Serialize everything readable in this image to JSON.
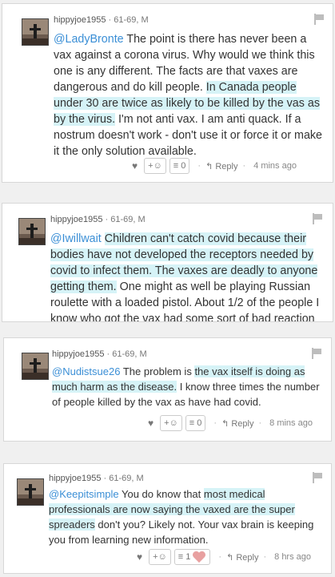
{
  "comments": [
    {
      "username": "hippyjoe1955",
      "meta": "· 61-69, M",
      "mention": "@LadyBronte",
      "body_a": " The point is there has never been a vax against a corona virus. Why would we think this one is any different. The facts are that vaxes are dangerous and do kill people. ",
      "body_hl": "In Canada people under 30 are twice as likely to be killed by the vas as by the virus.",
      "body_b": " I'm not anti vax. I am anti quack. If a nostrum doesn't work - don't use it or force it or make it the only solution available.",
      "react": "+☺",
      "replies": "0",
      "reply_label": "Reply",
      "time": "4 mins ago"
    },
    {
      "username": "hippyjoe1955",
      "meta": "· 61-69, M",
      "mention": "@Iwillwait",
      "body_hl": "Children can't catch covid because their bodies have not developed the receptors needed by covid to infect them. The vaxes are deadly to anyone getting them.",
      "body_b": " One might as well be playing Russian roulette with a loaded pistol. About 1/2 of the people I know who got the vax had some sort of bad reaction or got covid or died and each is"
    },
    {
      "username": "hippyjoe1955",
      "meta": "· 61-69, M",
      "mention": "@Nudistsue26",
      "body_a": " The problem is ",
      "body_hl": "the vax itself is doing as much harm as the disease.",
      "body_b": " I know three times the number of people killed by the vax as have had covid.",
      "react": "+☺",
      "replies": "0",
      "reply_label": "Reply",
      "time": "8 mins ago"
    },
    {
      "username": "hippyjoe1955",
      "meta": "· 61-69, M",
      "mention": "@Keepitsimple",
      "body_a": " You do know that ",
      "body_hl": "most medical professionals are now saying the vaxed are the super spreaders",
      "body_b": " don't you? Likely not. Your vax brain is keeping you from learning new information.",
      "react": "+☺",
      "replies": "1",
      "reply_label": "Reply",
      "time": "8 hrs ago"
    }
  ],
  "colors": {
    "mention": "#3b8fd6",
    "highlight": "#d6f3f7",
    "heart": "#e8a0a0"
  },
  "icons": [
    "heart-icon",
    "smiley-icon",
    "list-icon",
    "reply-arrow-icon",
    "flag-icon",
    "heart-reaction-icon"
  ]
}
